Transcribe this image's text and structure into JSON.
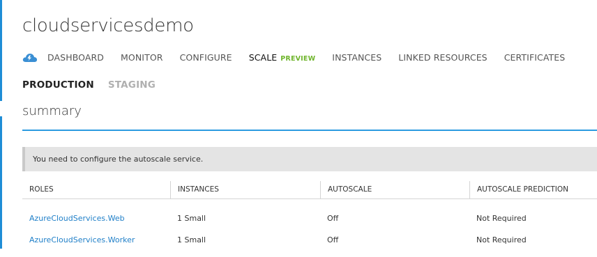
{
  "page": {
    "title": "cloudservicesdemo"
  },
  "nav": {
    "icon": "cloud-service-icon",
    "tabs": [
      {
        "label": "DASHBOARD"
      },
      {
        "label": "MONITOR"
      },
      {
        "label": "CONFIGURE"
      },
      {
        "label": "SCALE",
        "badge": "PREVIEW"
      },
      {
        "label": "INSTANCES"
      },
      {
        "label": "LINKED RESOURCES"
      },
      {
        "label": "CERTIFICATES"
      }
    ],
    "active": "SCALE"
  },
  "environment": {
    "tabs": [
      {
        "label": "PRODUCTION"
      },
      {
        "label": "STAGING"
      }
    ],
    "active": "PRODUCTION"
  },
  "summary": {
    "heading": "summary"
  },
  "notice": {
    "text": "You need to configure the autoscale service."
  },
  "roles_table": {
    "columns": [
      "ROLES",
      "INSTANCES",
      "AUTOSCALE",
      "AUTOSCALE PREDICTION"
    ],
    "rows": [
      [
        "AzureCloudServices.Web",
        "1 Small",
        "Off",
        "Not Required"
      ],
      [
        "AzureCloudServices.Worker",
        "1 Small",
        "Off",
        "Not Required"
      ]
    ]
  },
  "colors": {
    "accent": "#2b9be0",
    "link": "#1f7fc8",
    "preview": "#6fb52c",
    "notice_bg": "#e4e4e4"
  }
}
